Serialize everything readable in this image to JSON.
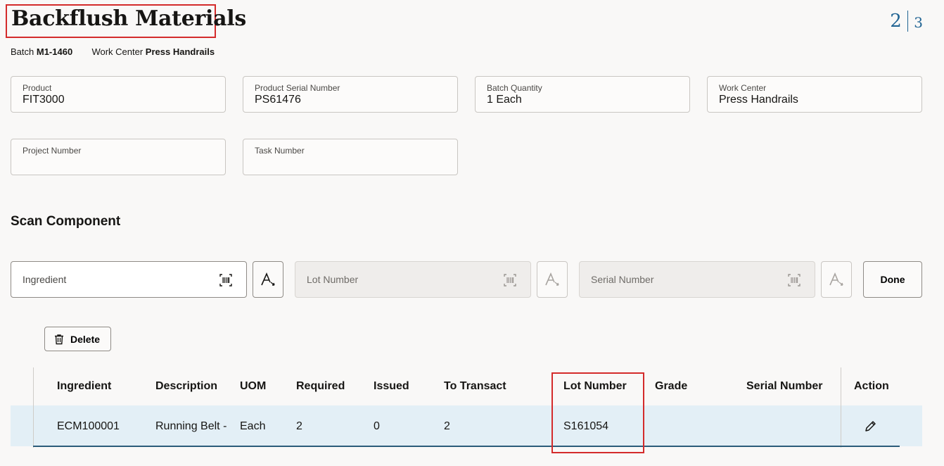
{
  "page": {
    "title": "Backflush Materials",
    "step_current": "2",
    "step_total": "3"
  },
  "meta": {
    "batch_label": "Batch",
    "batch_value": "M1-1460",
    "work_center_label": "Work Center",
    "work_center_value": "Press Handrails"
  },
  "fields": {
    "product": {
      "label": "Product",
      "value": "FIT3000"
    },
    "product_serial": {
      "label": "Product Serial Number",
      "value": "PS61476"
    },
    "batch_quantity": {
      "label": "Batch Quantity",
      "value": "1 Each"
    },
    "work_center": {
      "label": "Work Center",
      "value": "Press Handrails"
    },
    "project_number": {
      "label": "Project Number",
      "value": ""
    },
    "task_number": {
      "label": "Task Number",
      "value": ""
    }
  },
  "scan": {
    "section_title": "Scan Component",
    "ingredient_placeholder": "Ingredient",
    "lot_placeholder": "Lot Number",
    "serial_placeholder": "Serial Number",
    "done_label": "Done"
  },
  "toolbar": {
    "delete_label": "Delete"
  },
  "table": {
    "headers": [
      "Ingredient",
      "Description",
      "UOM",
      "Required",
      "Issued",
      "To Transact",
      "Lot Number",
      "Grade",
      "Serial Number",
      "Action"
    ],
    "rows": [
      {
        "ingredient": "ECM100001",
        "description": "Running Belt -",
        "uom": "Each",
        "required": "2",
        "issued": "0",
        "to_transact": "2",
        "lot_number": "S161054",
        "grade": "",
        "serial_number": ""
      }
    ]
  },
  "colors": {
    "highlight_box": "#d42b2b",
    "row_selected_bg": "#e3eff6",
    "step_indicator": "#216493"
  },
  "icons": [
    "barcode-icon",
    "ocr-scan-icon",
    "trash-icon",
    "pencil-icon"
  ]
}
